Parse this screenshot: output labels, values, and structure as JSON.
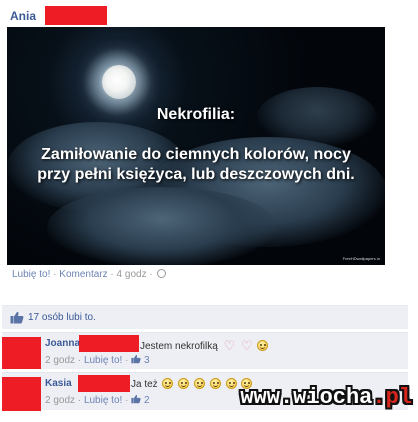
{
  "post": {
    "author": "Ania",
    "image": {
      "heading": "Nekrofilia:",
      "line1": "Zamiłowanie do ciemnych kolorów, nocy",
      "line2": "przy pełni księżyca, lub deszczowych dni.",
      "credit": "FreeHDwallpapers.in"
    },
    "actions": {
      "like": "Lubię to!",
      "comment": "Komentarz",
      "time": "4 godz"
    }
  },
  "likes": {
    "text": "17 osób lubi to."
  },
  "comments": [
    {
      "name": "Joanna",
      "text": "Jestem nekrofilką",
      "time": "2 godz",
      "like_label": "Lubię to!",
      "like_count": "3"
    },
    {
      "name": "Kasia",
      "text": "Ja też",
      "time": "2 godz",
      "like_label": "Lubię to!",
      "like_count": "2"
    }
  ],
  "watermark": {
    "main": "www.wiocha",
    "suffix": ".pl"
  },
  "colors": {
    "link": "#3b5998",
    "redaction": "#ee1c24",
    "comment_bg": "#edeff4"
  }
}
